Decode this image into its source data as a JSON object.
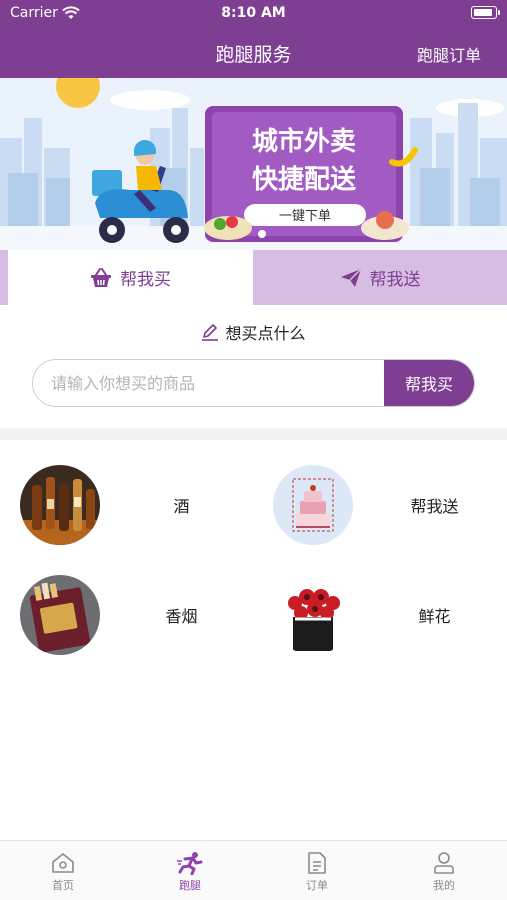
{
  "status_bar": {
    "carrier": "Carrier",
    "time": "8:10 AM",
    "battery_level": 0.9
  },
  "header": {
    "title": "跑腿服务",
    "right_link": "跑腿订单"
  },
  "banner": {
    "line1": "城市外卖",
    "line2": "快捷配送",
    "button": "一键下单"
  },
  "tabs": [
    {
      "label": "帮我买",
      "icon": "basket-icon",
      "active": true
    },
    {
      "label": "帮我送",
      "icon": "paper-plane-icon",
      "active": false
    }
  ],
  "section": {
    "subtitle": "想买点什么",
    "icon": "pencil-icon"
  },
  "search": {
    "placeholder": "请输入你想买的商品",
    "button": "帮我买"
  },
  "categories": [
    {
      "label": "酒",
      "image": "liquor-bottles"
    },
    {
      "label": "帮我送",
      "image": "birthday-cake"
    },
    {
      "label": "香烟",
      "image": "cigarette-pack"
    },
    {
      "label": "鲜花",
      "image": "rose-bouquet"
    }
  ],
  "tabbar": [
    {
      "label": "首页",
      "icon": "home-icon",
      "active": false
    },
    {
      "label": "跑腿",
      "icon": "runner-icon",
      "active": true
    },
    {
      "label": "订单",
      "icon": "document-icon",
      "active": false
    },
    {
      "label": "我的",
      "icon": "user-icon",
      "active": false
    }
  ],
  "colors": {
    "primary": "#7e3f93",
    "tab_inactive_bg": "#d8bde3",
    "active_tab_icon": "#8e44ad"
  }
}
